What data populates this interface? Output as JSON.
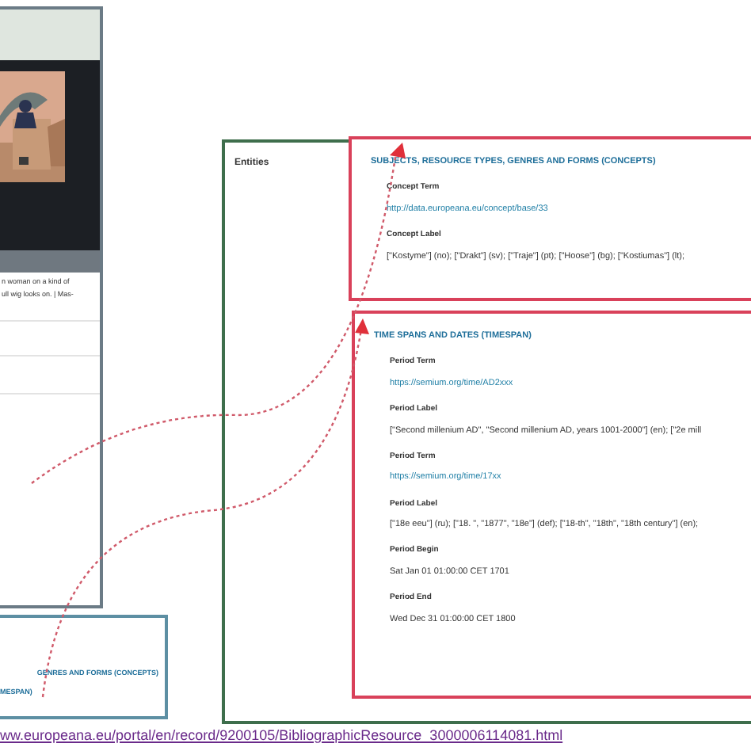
{
  "left_screenshot": {
    "caption_lines": [
      "n woman on a kind of",
      "ull wig looks on. | Mas-"
    ]
  },
  "inset": {
    "lines": [
      "GENRES AND FORMS (CONCEPTS)",
      "MESPAN)"
    ]
  },
  "entities_panel": {
    "label": "Entities",
    "sections": [
      {
        "title": "SUBJECTS, RESOURCE TYPES, GENRES AND FORMS (CONCEPTS)",
        "fields": [
          {
            "label": "Concept Term",
            "value": "http://data.europeana.eu/concept/base/33",
            "kind": "link"
          },
          {
            "label": "Concept Label",
            "value": "[\"Kostyme\"] (no); [\"Drakt\"] (sv); [\"Traje\"] (pt); [\"Hoose\"] (bg); [\"Kostiumas\"] (lt);",
            "kind": "text"
          }
        ]
      },
      {
        "title": "TIME SPANS AND DATES (TIMESPAN)",
        "fields": [
          {
            "label": "Period Term",
            "value": "https://semium.org/time/AD2xxx",
            "kind": "link"
          },
          {
            "label": "Period Label",
            "value": "[\"Second millenium AD\", \"Second millenium AD, years 1001-2000\"] (en); [\"2e mill",
            "kind": "text"
          },
          {
            "label": "Period Term",
            "value": "https://semium.org/time/17xx",
            "kind": "link"
          },
          {
            "label": "Period Label",
            "value": "[\"18e eeu\"] (ru); [\"18. \", \"1877\", \"18e\"] (def); [\"18-th\", \"18th\", \"18th century\"] (en);",
            "kind": "text"
          },
          {
            "label": "Period Begin",
            "value": "Sat Jan 01 01:00:00 CET 1701",
            "kind": "text"
          },
          {
            "label": "Period End",
            "value": "Wed Dec 31 01:00:00 CET 1800",
            "kind": "text"
          }
        ]
      }
    ]
  },
  "source_url": "ww.europeana.eu/portal/en/record/9200105/BibliographicResource_3000006114081.html"
}
